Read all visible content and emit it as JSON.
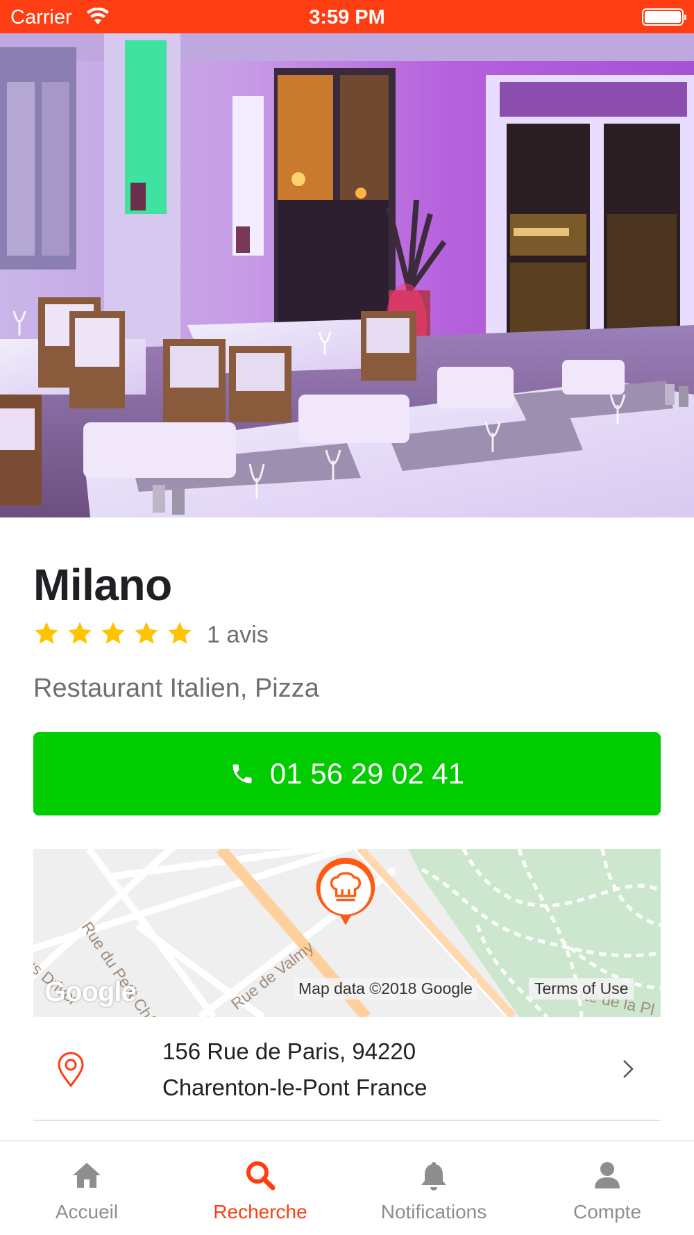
{
  "status_bar": {
    "carrier": "Carrier",
    "time": "3:59 PM"
  },
  "restaurant": {
    "name": "Milano",
    "rating": 5,
    "rating_max": 5,
    "review_count": "1 avis",
    "categories": "Restaurant Italien, Pizza",
    "phone": "01 56 29 02 41",
    "address_line1": "156 Rue de Paris, 94220",
    "address_line2": "Charenton-le-Pont France"
  },
  "map": {
    "street_labels": [
      "Rue du Petit Château",
      "Rue de Valmy",
      "ius Driver",
      "rte de la Pl"
    ],
    "attribution": "Map data ©2018 Google",
    "terms": "Terms of Use",
    "logo": "Google",
    "marker_icon": "chef-hat-icon"
  },
  "tab_bar": {
    "tabs": [
      {
        "label": "Accueil",
        "icon": "home-icon"
      },
      {
        "label": "Recherche",
        "icon": "search-icon"
      },
      {
        "label": "Notifications",
        "icon": "bell-icon"
      },
      {
        "label": "Compte",
        "icon": "user-icon"
      }
    ],
    "active_index": 1
  },
  "colors": {
    "accent": "#ff3d12",
    "call_button": "#00cc00",
    "star": "#ffc400",
    "inactive_tab": "#8e8e8e"
  }
}
